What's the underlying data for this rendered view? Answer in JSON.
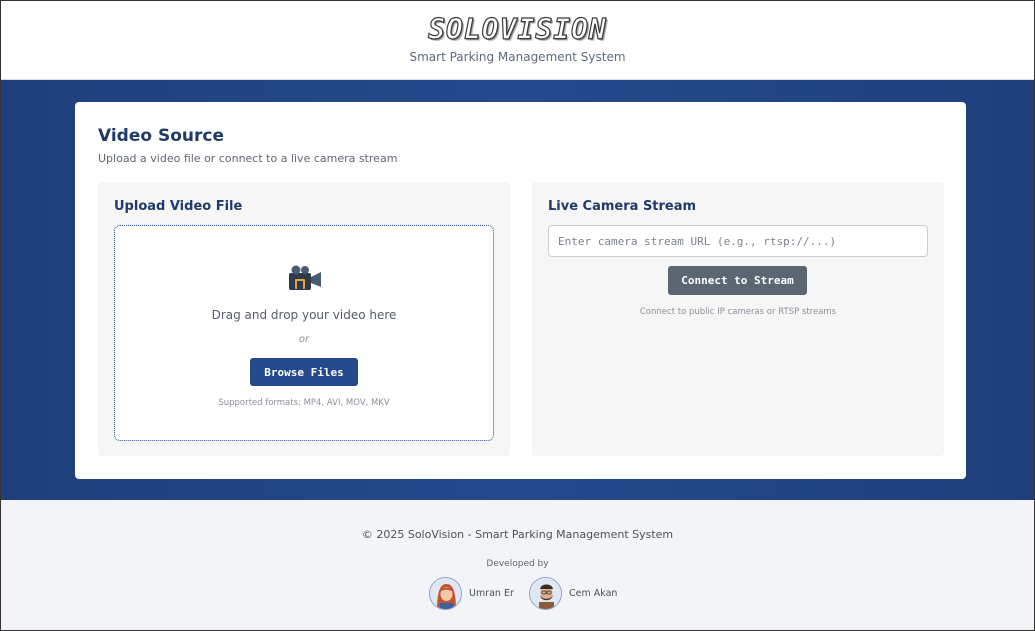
{
  "header": {
    "logo": "SOLOVISION",
    "tagline": "Smart Parking Management System"
  },
  "video_source": {
    "title": "Video Source",
    "subtitle": "Upload a video file or connect to a live camera stream",
    "upload": {
      "title": "Upload Video File",
      "icon": "video-camera-icon",
      "drop_text": "Drag and drop your video here",
      "or_text": "or",
      "browse_label": "Browse Files",
      "formats": "Supported formats: MP4, AVI, MOV, MKV"
    },
    "stream": {
      "title": "Live Camera Stream",
      "url_placeholder": "Enter camera stream URL (e.g., rtsp://...)",
      "url_value": "",
      "connect_label": "Connect to Stream",
      "hint": "Connect to public IP cameras or RTSP streams"
    }
  },
  "footer": {
    "copyright": "© 2025 SoloVision - Smart Parking Management System",
    "developed_by": "Developed by",
    "developers": [
      {
        "name": "Umran Er",
        "avatar": "avatar-woman-icon"
      },
      {
        "name": "Cem Akan",
        "avatar": "avatar-man-icon"
      }
    ]
  },
  "colors": {
    "brand_blue": "#244a8c",
    "title_blue": "#1f3a6b",
    "connect_gray": "#5b6672"
  }
}
